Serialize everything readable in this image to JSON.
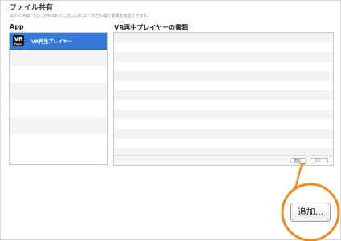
{
  "section": {
    "title": "ファイル共有",
    "subtitle": "以下の App では、iPhone とこのコンピュータとの間で書類を転送できます。"
  },
  "apps_column": {
    "header": "App",
    "items": [
      {
        "name": "VR再生プレイヤー",
        "icon_label": "VR",
        "icon_sublabel": "Player",
        "selected": true
      }
    ]
  },
  "docs_column": {
    "header": "VR再生プレイヤーの書類",
    "add_button": "追加...",
    "save_button": "保存..."
  },
  "callout": {
    "add_button": "追加...",
    "highlight_color": "#f08a1c"
  },
  "colors": {
    "selection": "#3478d8",
    "highlight": "#f08a1c"
  }
}
